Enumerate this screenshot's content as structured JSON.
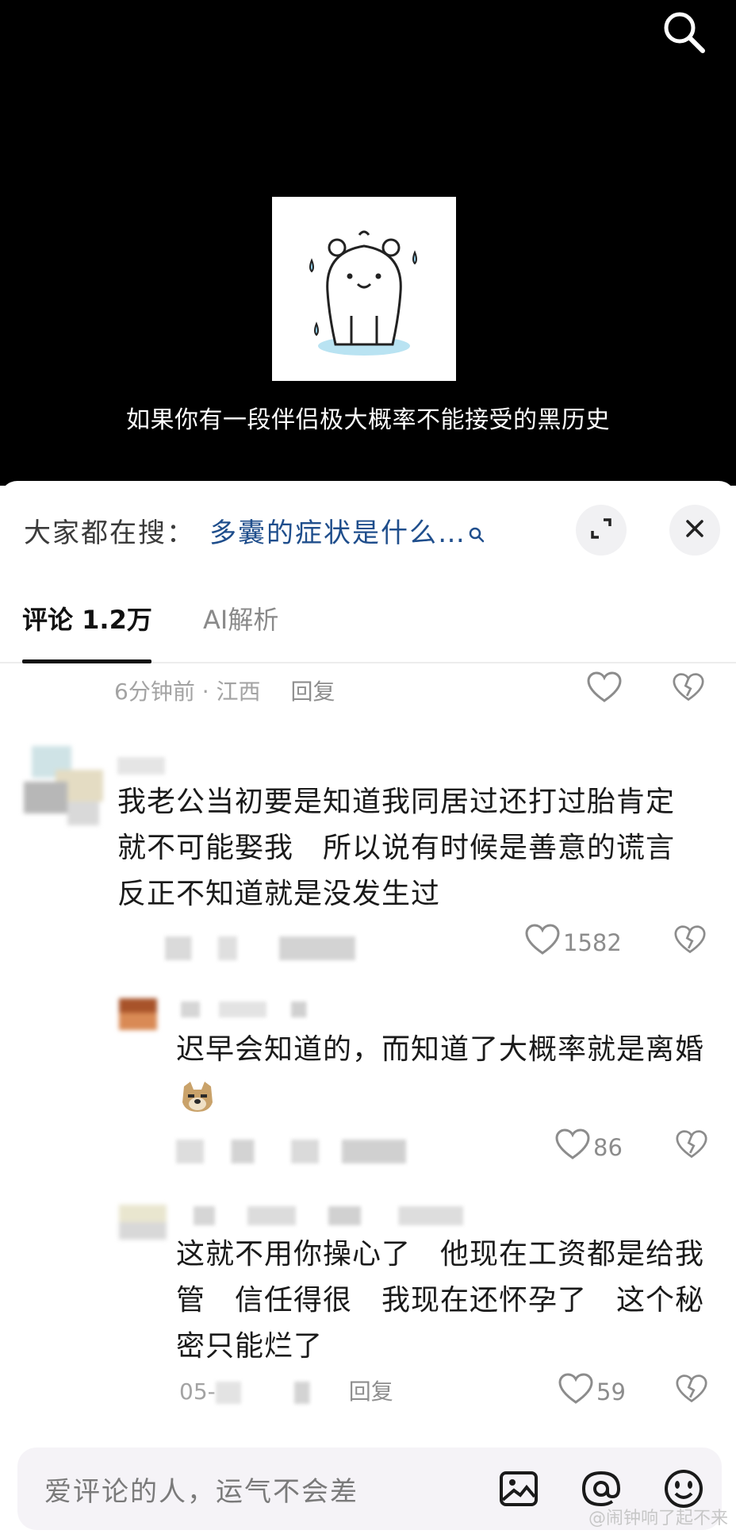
{
  "video": {
    "caption": "如果你有一段伴侣极大概率不能接受的黑历史",
    "search_icon": "search-icon",
    "sticker": "sweating-bear-sticker"
  },
  "sheet": {
    "trending_label": "大家都在搜：",
    "trending_query": "多囊的症状是什么…",
    "tabs": [
      {
        "label": "评论 1.2万"
      },
      {
        "label": "AI解析"
      }
    ]
  },
  "comments": {
    "top_meta": {
      "time": "6分钟前 · 江西",
      "reply": "回复"
    },
    "c1": {
      "text": "我老公当初要是知道我同居过还打过胎肯定就不可能娶我　所以说有时候是善意的谎言　反正不知道就是没发生过",
      "likes": "1582"
    },
    "r1": {
      "text": "迟早会知道的，而知道了大概率就是离婚",
      "likes": "86"
    },
    "r2": {
      "text": "这就不用你操心了　他现在工资都是给我管　信任得很　我现在还怀孕了　这个秘密只能烂了",
      "meta": "05-",
      "reply": "回复",
      "likes": "59"
    }
  },
  "input": {
    "placeholder": "爱评论的人，运气不会差",
    "icons": [
      "image-icon",
      "at-icon",
      "emoji-icon"
    ]
  },
  "watermark": "@闹钟响了起不来",
  "colors": {
    "link": "#1f4e8c",
    "meta": "#a3a3a3",
    "bg": "#ffffff"
  }
}
